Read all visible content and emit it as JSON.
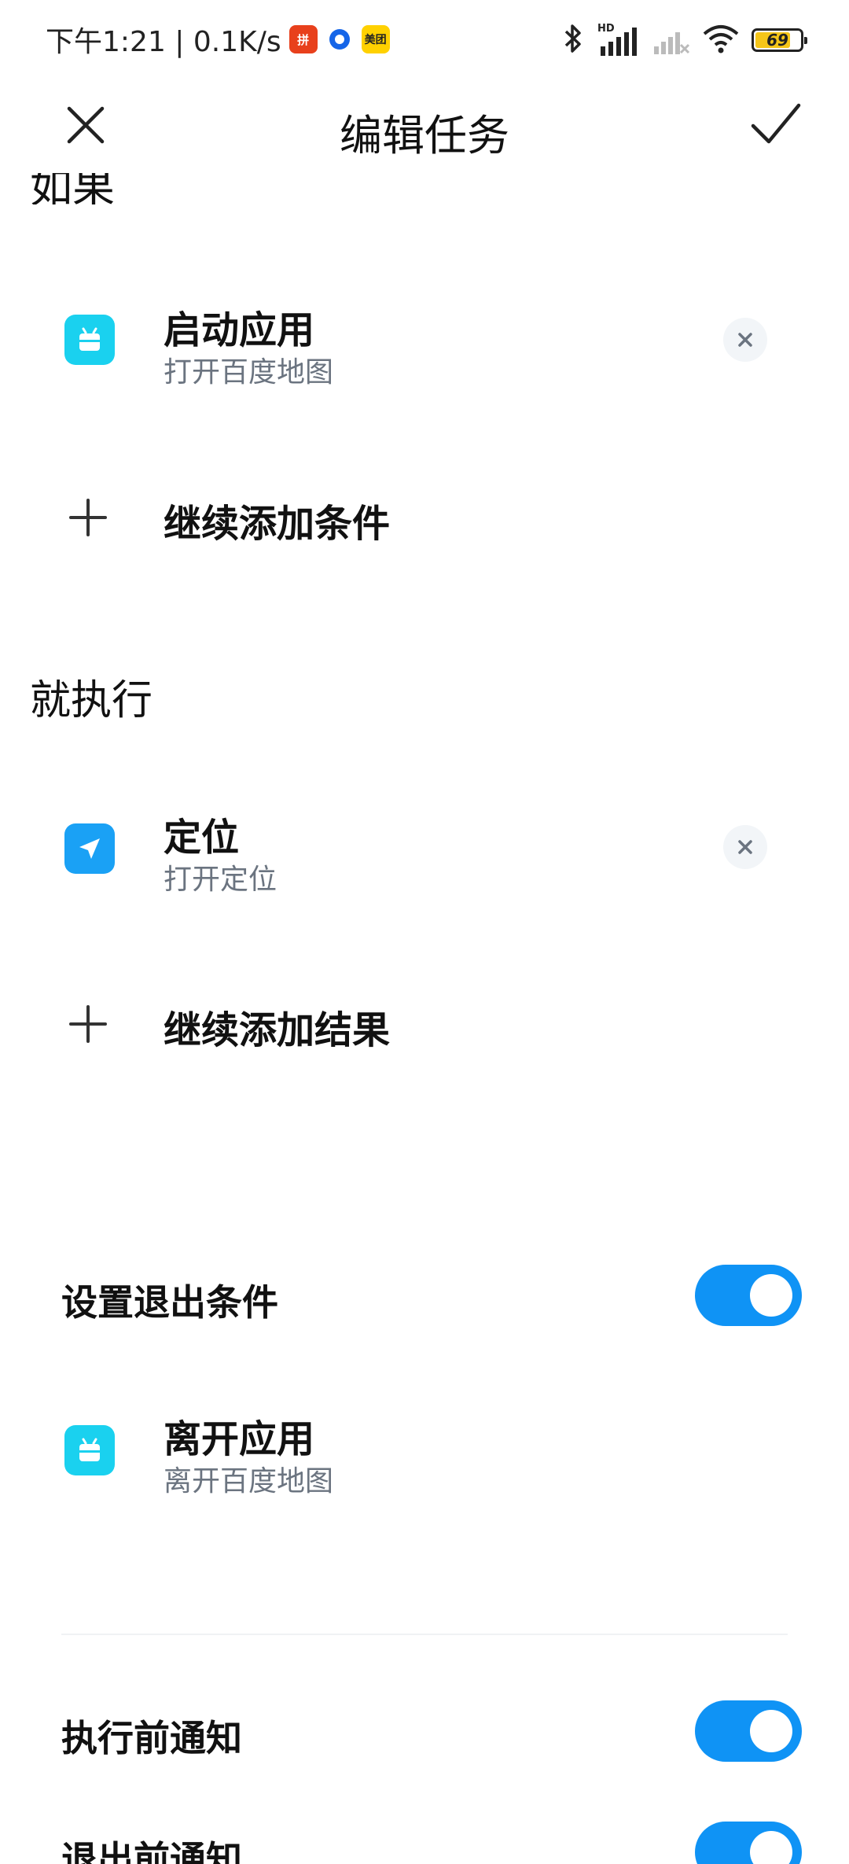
{
  "status_bar": {
    "time_speed": "下午1:21 | 0.1K/s",
    "badge_pdd": "拼",
    "badge_meituan": "美团",
    "hd_label": "HD",
    "battery": "69"
  },
  "header": {
    "title": "编辑任务"
  },
  "if_section": {
    "partial_label": "如果"
  },
  "conditions": [
    {
      "title": "启动应用",
      "subtitle": "打开百度地图",
      "icon": "android-app-icon"
    }
  ],
  "add_condition_label": "继续添加条件",
  "then_section": {
    "title": "就执行"
  },
  "results": [
    {
      "title": "定位",
      "subtitle": "打开定位",
      "icon": "location-arrow-icon"
    }
  ],
  "add_result_label": "继续添加结果",
  "exit_condition": {
    "label": "设置退出条件",
    "enabled": true,
    "item": {
      "title": "离开应用",
      "subtitle": "离开百度地图",
      "icon": "android-app-icon"
    }
  },
  "notifications": [
    {
      "label": "执行前通知",
      "enabled": true
    },
    {
      "label": "退出前通知",
      "enabled": true
    }
  ],
  "colors": {
    "accent": "#0f93f5",
    "app_icon": "#1ad1ef",
    "location_icon": "#1aa1f5",
    "subtitle": "#6b7480"
  }
}
